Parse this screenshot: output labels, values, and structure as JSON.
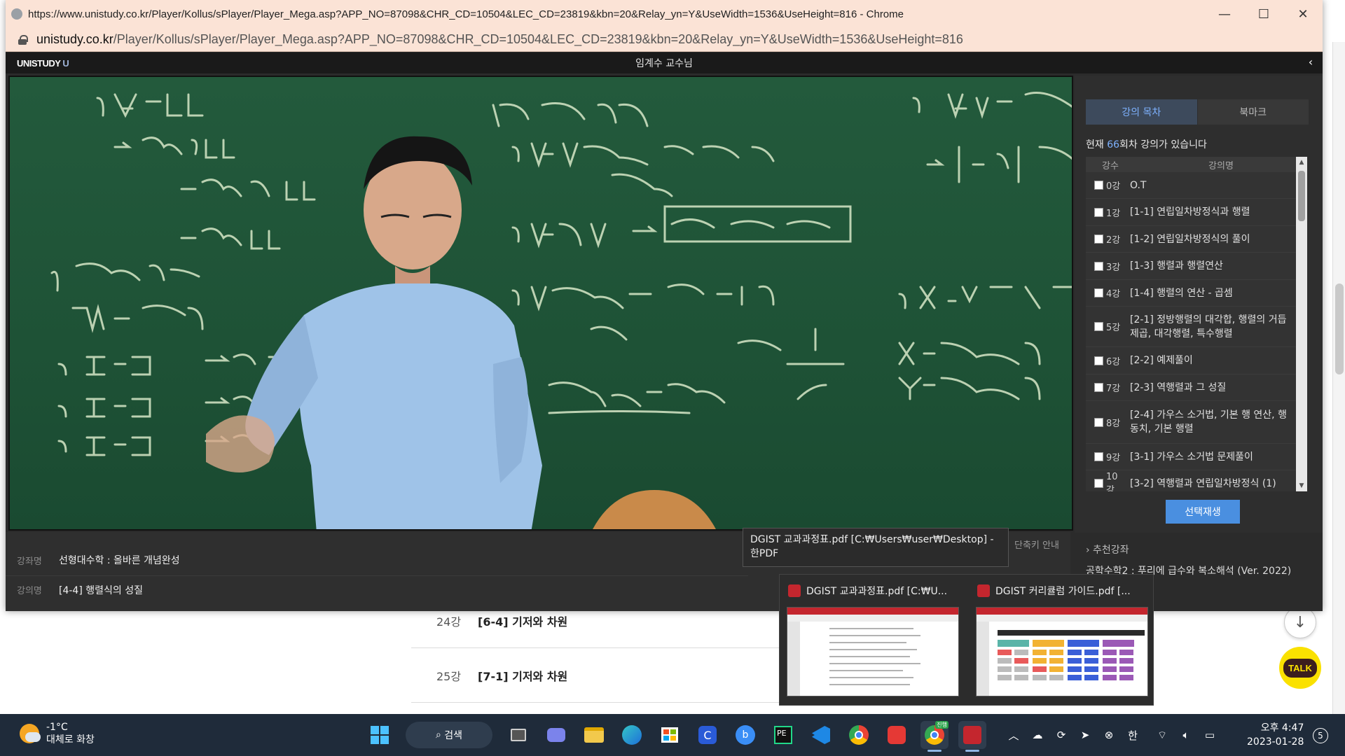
{
  "window": {
    "title": "https://www.unistudy.co.kr/Player/Kollus/sPlayer/Player_Mega.asp?APP_NO=87098&CHR_CD=10504&LEC_CD=23819&kbn=20&Relay_yn=Y&UseWidth=1536&UseHeight=816 - Chrome",
    "url_domain": "unistudy.co.kr",
    "url_path": "/Player/Kollus/sPlayer/Player_Mega.asp?APP_NO=87098&CHR_CD=10504&LEC_CD=23819&kbn=20&Relay_yn=Y&UseWidth=1536&UseHeight=816",
    "minimize": "—",
    "maximize": "☐",
    "close": "✕"
  },
  "player": {
    "logo_main": "UNISTUDY",
    "logo_mark": "U",
    "professor": "임계수 교수님",
    "collapse": "‹"
  },
  "sidebar": {
    "tab_toc": "강의 목차",
    "tab_bookmark": "북마크",
    "count_prefix": "현재 ",
    "count_number": "66",
    "count_suffix": "회차 강의가 있습니다",
    "col_no": "강수",
    "col_name": "강의명",
    "lectures": [
      {
        "no": "0강",
        "name": "O.T"
      },
      {
        "no": "1강",
        "name": "[1-1] 연립일차방정식과 행렬"
      },
      {
        "no": "2강",
        "name": "[1-2] 연립일차방정식의 풀이"
      },
      {
        "no": "3강",
        "name": "[1-3] 행렬과 행렬연산"
      },
      {
        "no": "4강",
        "name": "[1-4] 행렬의 연산 - 곱셈"
      },
      {
        "no": "5강",
        "name": "[2-1] 정방행렬의 대각합, 행렬의 거듭제곱, 대각행렬, 특수행렬"
      },
      {
        "no": "6강",
        "name": "[2-2] 예제풀이"
      },
      {
        "no": "7강",
        "name": "[2-3] 역행렬과 그 성질"
      },
      {
        "no": "8강",
        "name": "[2-4] 가우스 소거법, 기본 행 연산, 행 동치, 기본 행렬"
      },
      {
        "no": "9강",
        "name": "[3-1] 가우스 소거법 문제풀이"
      },
      {
        "no": "10강",
        "name": "[3-2] 역행렬과 연립일차방정식 (1)"
      }
    ],
    "play_selected": "선택재생",
    "recommend_title": "› 추천강좌",
    "recommend_item": "공학수학2 : 푸리에 급수와 복소해석 (Ver. 2022)"
  },
  "info": {
    "course_label": "강좌명",
    "course_value": "선형대수학 : 올바른 개념완성",
    "lecture_label": "강의명",
    "lecture_value": "[4-4] 행렬식의 성질",
    "shortcut": "단축키 안내"
  },
  "background_list": [
    {
      "no": "24강",
      "title": "[6-4] 기저와 차원"
    },
    {
      "no": "25강",
      "title": "[7-1] 기저와 차원"
    }
  ],
  "background_buttons": {
    "down": "↓",
    "talk": "TALK"
  },
  "tooltip": {
    "text": "DGIST 교과과정표.pdf [C:₩Users₩user₩Desktop] - 한PDF"
  },
  "taskbar_preview": [
    {
      "title": "DGIST 교과과정표.pdf [C:₩U..."
    },
    {
      "title": "DGIST 커리큘럼 가이드.pdf [..."
    }
  ],
  "taskbar": {
    "temp": "-1°C",
    "weather": "대체로 화창",
    "search": "검색",
    "badge": "진행",
    "ime": "한",
    "time": "오후 4:47",
    "date": "2023-01-28",
    "notifications": "5"
  },
  "colors": {
    "accent": "#4a8fe0",
    "highlight": "#7eb2ff",
    "titlebar": "#fbe3d6",
    "board": "#1e5236"
  }
}
